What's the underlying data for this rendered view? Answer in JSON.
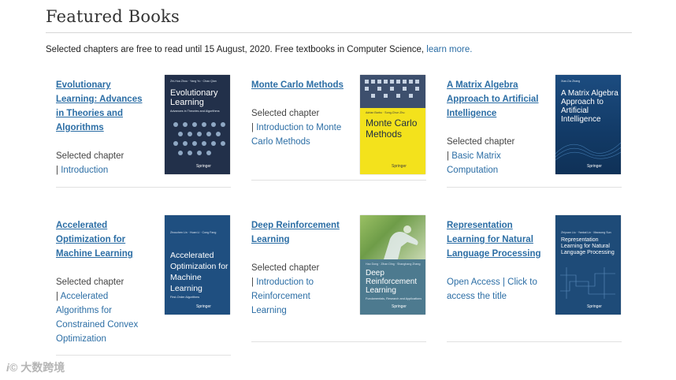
{
  "header": {
    "title": "Featured Books"
  },
  "intro": {
    "text": "Selected chapters are free to read until 15 August, 2020.  Free textbooks in Computer Science, ",
    "link": "learn more."
  },
  "books": [
    {
      "title": "Evolutionary Learning: Advances in Theories and Algorithms",
      "label": "Selected chapter",
      "link": "Introduction",
      "cover": {
        "authors": "Zhi-Hua Zhou · Yang Yu · Chao Qian",
        "title": "Evolutionary Learning",
        "subtitle": "Advances in Theories and Algorithms",
        "publisher": "Springer",
        "bg": "#22304a"
      }
    },
    {
      "title": "Monte Carlo Methods",
      "label": "Selected chapter",
      "link": "Introduction to Monte Carlo Methods",
      "cover": {
        "authors": "Adrian Barbu · Song-Chun Zhu",
        "title": "Monte Carlo Methods",
        "subtitle": "",
        "publisher": "Springer",
        "bg": "#f3e21c"
      }
    },
    {
      "title": "A Matrix Algebra Approach to Artificial Intelligence",
      "label": "Selected  chapter",
      "link": "Basic Matrix Computation",
      "cover": {
        "authors": "Xian-Da Zhang",
        "title": "A Matrix Algebra Approach to Artificial Intelligence",
        "subtitle": "",
        "publisher": "Springer",
        "bg": "#15406e"
      }
    },
    {
      "title": "Accelerated Optimization for Machine Learning",
      "label": "Selected  chapter",
      "link": "Accelerated Algorithms for Constrained Convex Optimization",
      "cover": {
        "authors": "Zhouchen Lin · Huan Li · Cong Fang",
        "title": "Accelerated Optimization for Machine Learning",
        "subtitle": "First-Order Algorithms",
        "publisher": "Springer",
        "bg": "#1f4f80"
      }
    },
    {
      "title": "Deep Reinforcement Learning",
      "label": "Selected  chapter",
      "link": "Introduction to Reinforcement Learning",
      "cover": {
        "authors": "Hao Dong · Zihan Ding · Shanghang Zhang",
        "title": "Deep Reinforcement Learning",
        "subtitle": "Fundamentals, Research and Applications",
        "publisher": "Springer",
        "bg": "#4d7a8f"
      }
    },
    {
      "title": "Representation Learning for Natural Language Processing",
      "label": "Open Access |  Click to access the title",
      "link": "",
      "cover": {
        "authors": "Zhiyuan Liu · Yankai Lin · Maosong Sun",
        "title": "Representation Learning for Natural Language Processing",
        "subtitle": "",
        "publisher": "Springer",
        "bg": "#1e4b78"
      }
    }
  ],
  "watermark": {
    "logo": "i©",
    "text": "大数跨境"
  }
}
